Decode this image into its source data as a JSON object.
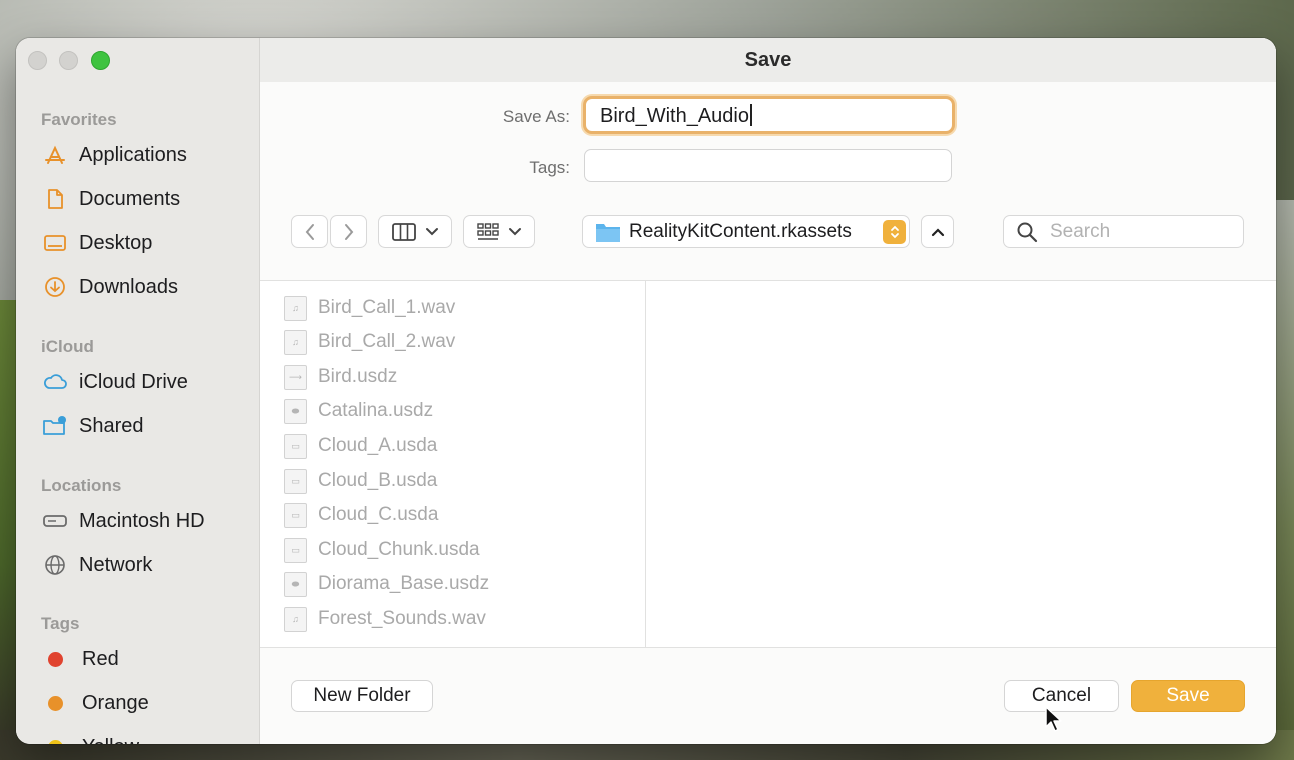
{
  "window": {
    "title": "Save"
  },
  "sidebar": {
    "sections": [
      {
        "label": "Favorites",
        "items": [
          {
            "label": "Applications",
            "icon": "applications-icon"
          },
          {
            "label": "Documents",
            "icon": "document-icon"
          },
          {
            "label": "Desktop",
            "icon": "desktop-icon"
          },
          {
            "label": "Downloads",
            "icon": "downloads-icon"
          }
        ]
      },
      {
        "label": "iCloud",
        "items": [
          {
            "label": "iCloud Drive",
            "icon": "icloud-icon"
          },
          {
            "label": "Shared",
            "icon": "shared-folder-icon"
          }
        ]
      },
      {
        "label": "Locations",
        "items": [
          {
            "label": "Macintosh HD",
            "icon": "hard-drive-icon"
          },
          {
            "label": "Network",
            "icon": "globe-icon"
          }
        ]
      },
      {
        "label": "Tags",
        "items": [
          {
            "label": "Red",
            "color": "#e0432f"
          },
          {
            "label": "Orange",
            "color": "#e8912a"
          },
          {
            "label": "Yellow",
            "color": "#efc31a"
          }
        ]
      }
    ]
  },
  "form": {
    "save_as_label": "Save As:",
    "save_as_value": "Bird_With_Audio",
    "tags_label": "Tags:",
    "tags_value": ""
  },
  "toolbar": {
    "location": "RealityKitContent.rkassets",
    "search_placeholder": "Search"
  },
  "files": [
    {
      "name": "Bird_Call_1.wav",
      "type": "audio"
    },
    {
      "name": "Bird_Call_2.wav",
      "type": "audio"
    },
    {
      "name": "Bird.usdz",
      "type": "usdz"
    },
    {
      "name": "Catalina.usdz",
      "type": "usdz"
    },
    {
      "name": "Cloud_A.usda",
      "type": "usda"
    },
    {
      "name": "Cloud_B.usda",
      "type": "usda"
    },
    {
      "name": "Cloud_C.usda",
      "type": "usda"
    },
    {
      "name": "Cloud_Chunk.usda",
      "type": "usda"
    },
    {
      "name": "Diorama_Base.usdz",
      "type": "usdz"
    },
    {
      "name": "Forest_Sounds.wav",
      "type": "audio"
    }
  ],
  "buttons": {
    "new_folder": "New Folder",
    "cancel": "Cancel",
    "save": "Save"
  },
  "colors": {
    "accent": "#f0b13c",
    "focus_ring": "#e9b26a"
  }
}
